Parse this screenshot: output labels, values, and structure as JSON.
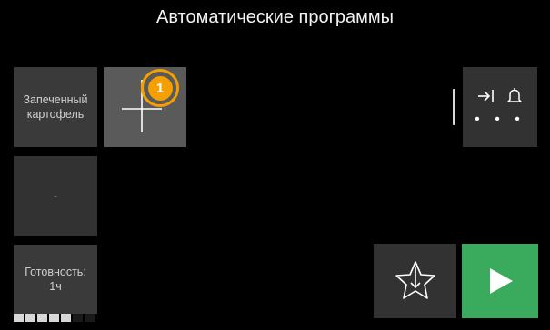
{
  "header": {
    "title": "Автоматические программы"
  },
  "programs": [
    {
      "label": "Запеченный картофель"
    },
    {
      "label": "-"
    }
  ],
  "add_program": {
    "badge": "1"
  },
  "readiness": {
    "label": "Готовность: 1ч",
    "progress": {
      "filled": 5,
      "total": 7
    }
  },
  "options": {
    "dots": "• • •",
    "icons": [
      "arrow-to-line-icon",
      "bell-icon"
    ]
  },
  "actions": {
    "favorite_icon": "star-with-down-arrow-icon",
    "start_icon": "play-icon",
    "start_color": "#3aaa5c"
  },
  "accent_color": "#f5a000"
}
